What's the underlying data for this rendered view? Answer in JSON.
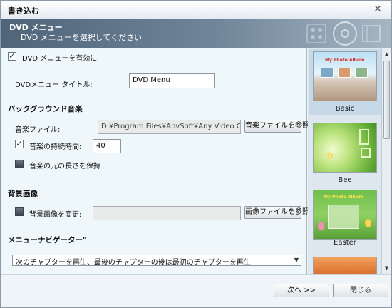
{
  "window": {
    "title": "書き込む",
    "close_glyph": "✕"
  },
  "header": {
    "title": "DVD メニュー",
    "subtitle": "DVD メニューを選択してください"
  },
  "options": {
    "enable_menu": {
      "label": "DVD メニューを有効に",
      "checked": true
    },
    "menu_title": {
      "label": "DVDメニュー タイトル:",
      "value": "DVD Menu"
    },
    "bgm": {
      "section": "バックグラウンド音楽",
      "file_label": "音楽ファイル:",
      "file_value": "D:¥Program Files¥AnvSoft¥Any Video Convert",
      "browse_label": "音楽ファイルを参照",
      "duration_label": "音楽の持続時間:",
      "duration_checked": true,
      "duration_value": "40",
      "keep_length_label": "音楽の元の長さを保持",
      "keep_length_checked": false
    },
    "bgimage": {
      "section": "背景画像",
      "change_label": "背景画像を変更:",
      "change_checked": false,
      "path_value": "",
      "browse_label": "画像ファイルを参照"
    },
    "navigator": {
      "section": "メニューナビゲーター\"",
      "selected": "次のチャプターを再生、最後のチャプターの後は最初のチャプターを再生"
    }
  },
  "templates": [
    {
      "name": "Basic",
      "selected": true,
      "thumb_text": "My Photo Album"
    },
    {
      "name": "Bee",
      "selected": false,
      "thumb_text": ""
    },
    {
      "name": "Easter",
      "selected": false,
      "thumb_text": "My Photo Album"
    }
  ],
  "footer": {
    "next_label": "次へ >>",
    "close_label": "閉じる"
  },
  "icons": {
    "check": "✓",
    "dropdown": "▼",
    "scroll_up": "▲",
    "scroll_down": "▼"
  }
}
